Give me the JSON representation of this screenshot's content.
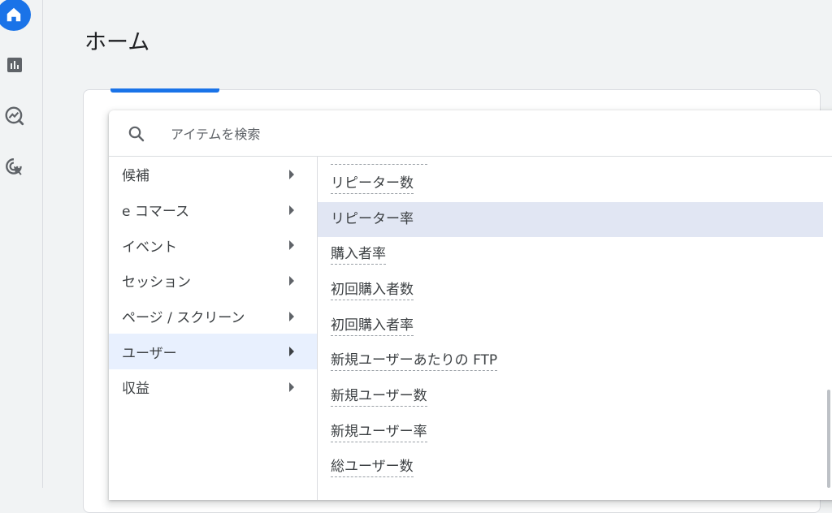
{
  "page": {
    "title": "ホーム"
  },
  "nav_rail": {
    "icons": [
      "home-icon",
      "reports-icon",
      "explore-icon",
      "advertising-icon"
    ],
    "accent": "#1a73e8"
  },
  "picker": {
    "search_placeholder": "アイテムを検索",
    "categories": [
      {
        "label": "候補",
        "active": false
      },
      {
        "label": "e コマース",
        "active": false
      },
      {
        "label": "イベント",
        "active": false
      },
      {
        "label": "セッション",
        "active": false
      },
      {
        "label": "ページ / スクリーン",
        "active": false
      },
      {
        "label": "ユーザー",
        "active": true
      },
      {
        "label": "収益",
        "active": false
      }
    ],
    "metrics": [
      {
        "label": "リピーター数",
        "highlighted": false
      },
      {
        "label": "リピーター率",
        "highlighted": true
      },
      {
        "label": "購入者率",
        "highlighted": false
      },
      {
        "label": "初回購入者数",
        "highlighted": false
      },
      {
        "label": "初回購入者率",
        "highlighted": false
      },
      {
        "label": "新規ユーザーあたりの FTP",
        "highlighted": false
      },
      {
        "label": "新規ユーザー数",
        "highlighted": false
      },
      {
        "label": "新規ユーザー率",
        "highlighted": false
      },
      {
        "label": "総ユーザー数",
        "highlighted": false
      }
    ],
    "highlight_color": "#e1e6f3",
    "active_category_color": "#e8f0fe"
  }
}
